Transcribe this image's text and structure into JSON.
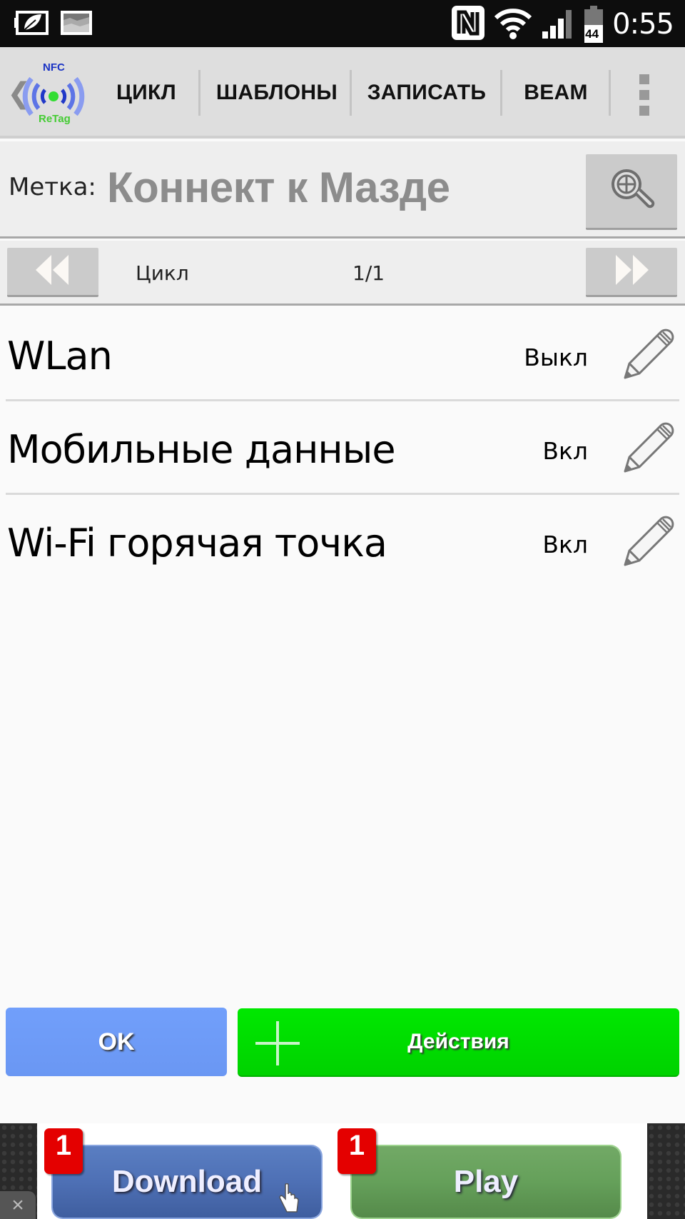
{
  "status_bar": {
    "time": "0:55",
    "battery_level": "44",
    "icons": [
      "eco-battery-icon",
      "gallery-notification-icon",
      "nfc-icon",
      "wifi-icon",
      "signal-icon",
      "battery-icon"
    ]
  },
  "action_bar": {
    "app_name": "NFC ReTag",
    "logo_text_top": "NFC",
    "logo_text_bottom": "ReTag",
    "tabs": [
      {
        "label": "ЦИКЛ"
      },
      {
        "label": "ШАБЛОНЫ"
      },
      {
        "label": "ЗАПИСАТЬ"
      },
      {
        "label": "BEAM"
      }
    ]
  },
  "tag": {
    "label": "Метка:",
    "name": "Коннект к Мазде"
  },
  "navigator": {
    "label": "Цикл",
    "position": "1/1"
  },
  "actions": [
    {
      "name": "WLan",
      "value": "Выкл"
    },
    {
      "name": "Мобильные данные",
      "value": "Вкл"
    },
    {
      "name": "Wi-Fi горячая точка",
      "value": "Вкл"
    }
  ],
  "buttons": {
    "ok": "OK",
    "actions": "Действия"
  },
  "ad": {
    "close": "×",
    "download": {
      "label": "Download",
      "badge": "1"
    },
    "play": {
      "label": "Play",
      "badge": "1"
    }
  },
  "colors": {
    "ok_button": "#6a9bf8",
    "actions_button": "#00dc00",
    "tag_name": "#8c8c8c"
  }
}
